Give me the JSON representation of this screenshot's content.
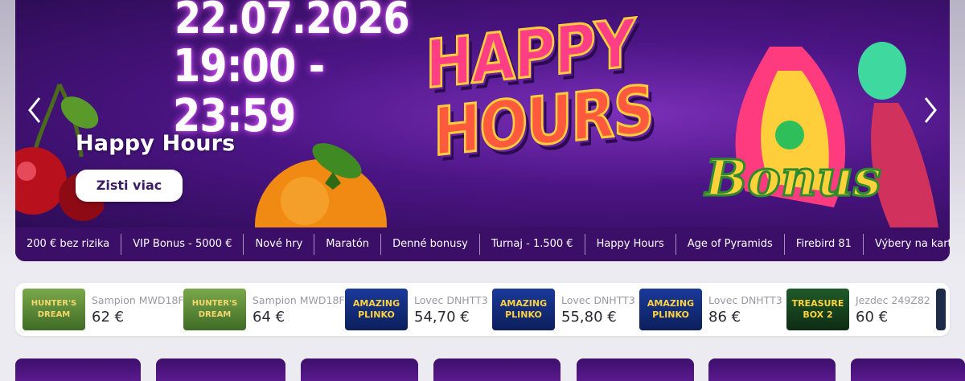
{
  "hero": {
    "date": "22.07.2026",
    "time": "19:00 - 23:59",
    "logo_line1": "HAPPY",
    "logo_line2": "HOURS",
    "logo_bonus": "Bonus",
    "title": "Happy Hours",
    "button_label": "Zisti viac",
    "prev_icon": "chevron-left-icon",
    "next_icon": "chevron-right-icon"
  },
  "nav": {
    "items": [
      {
        "label": "200 € bez rizika"
      },
      {
        "label": "VIP Bonus - 5000 €"
      },
      {
        "label": "Nové hry"
      },
      {
        "label": "Maratón"
      },
      {
        "label": "Denné bonusy"
      },
      {
        "label": "Turnaj - 1.500 €"
      },
      {
        "label": "Happy Hours"
      },
      {
        "label": "Age of Pyramids"
      },
      {
        "label": "Firebird 81"
      },
      {
        "label": "Výbery na kartu"
      }
    ]
  },
  "winners": [
    {
      "name": "Sampion MWD18F",
      "amount": "62 €",
      "game_art": "HUNTER'S DREAM"
    },
    {
      "name": "Sampion MWD18F",
      "amount": "64 €",
      "game_art": "HUNTER'S DREAM"
    },
    {
      "name": "Lovec DNHTT3",
      "amount": "54,70 €",
      "game_art": "AMAZING PLINKO"
    },
    {
      "name": "Lovec DNHTT3",
      "amount": "55,80 €",
      "game_art": "AMAZING PLINKO"
    },
    {
      "name": "Lovec DNHTT3",
      "amount": "86 €",
      "game_art": "AMAZING PLINKO"
    },
    {
      "name": "Jezdec 249Z82",
      "amount": "60 €",
      "game_art": "TREASURE BOX 2"
    }
  ],
  "colors": {
    "hero_bg": "#4c1585",
    "nav_bg": "#3b0f68",
    "page_bg": "#ecebf1",
    "button_text": "#3b1d63"
  }
}
